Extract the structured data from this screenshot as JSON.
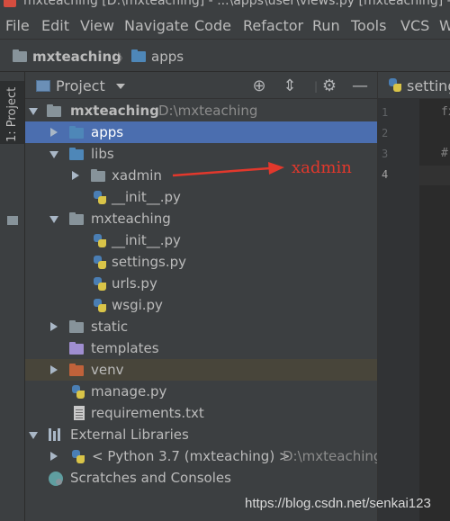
{
  "titlebar": {
    "text": "mxteaching [D:\\mxteaching] - ...\\apps\\user\\views.py [mxteaching] - W"
  },
  "menu": [
    "File",
    "Edit",
    "View",
    "Navigate",
    "Code",
    "Refactor",
    "Run",
    "Tools",
    "VCS",
    "W"
  ],
  "breadcrumb": [
    "mxteaching",
    "apps"
  ],
  "toolstrip": {
    "tab_label": "1: Project"
  },
  "panel": {
    "title": "Project"
  },
  "tree": {
    "root_label": "mxteaching",
    "root_path": "D:\\mxteaching",
    "apps": "apps",
    "libs": "libs",
    "xadmin": "xadmin",
    "libs_init": "__init__.py",
    "mxteaching_pkg": "mxteaching",
    "pkg_init": "__init__.py",
    "settings": "settings.py",
    "urls": "urls.py",
    "wsgi": "wsgi.py",
    "static": "static",
    "templates": "templates",
    "venv": "venv",
    "manage": "manage.py",
    "requirements": "requirements.txt",
    "external_libraries": "External Libraries",
    "python_sdk": "< Python 3.7 (mxteaching) >",
    "python_path": "D:\\mxteaching",
    "scratches": "Scratches and Consoles"
  },
  "editor": {
    "tab_label": "setting",
    "line_numbers": [
      "1",
      "2",
      "3",
      "4"
    ],
    "line1_code": "fx",
    "line3_code": "#"
  },
  "annotation": {
    "text": "xadmin",
    "color": "#e2382c"
  },
  "watermark": "https://blog.csdn.net/senkai123",
  "colors": {
    "selection": "#4b6eaf",
    "venv_highlight": "#48453a",
    "blue_folder": "#4e87b8",
    "orange_folder": "#c0623a",
    "purple_folder": "#9f8ed0"
  }
}
